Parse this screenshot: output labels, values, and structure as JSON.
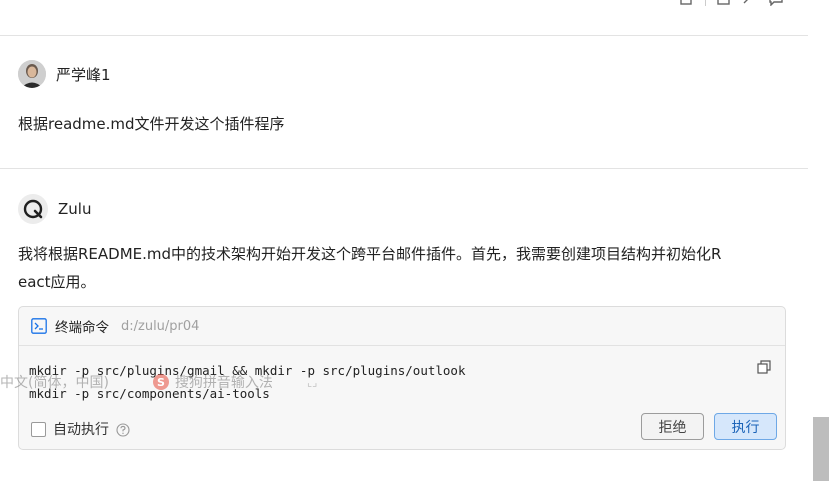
{
  "user_message": {
    "author": "严学峰1",
    "text": "根据readme.md文件开发这个插件程序"
  },
  "ai_message": {
    "author": "Zulu",
    "text_line1": "我将根据README.md中的技术架构开始开发这个跨平台邮件插件。首先，我需要创建项目结构并初始化R",
    "text_line2": "eact应用。"
  },
  "terminal": {
    "title": "终端命令",
    "path": "d:/zulu/pr04",
    "command_line1": "mkdir -p src/plugins/gmail && mkdir -p src/plugins/outlook",
    "command_line2": "mkdir -p src/components/ai-tools",
    "auto_exec_label": "自动执行",
    "reject_label": "拒绝",
    "execute_label": "执行"
  },
  "ime": {
    "lang": "中文(简体，中国)",
    "name": "搜狗拼音输入法",
    "logo": "S"
  },
  "colors": {
    "execute_bg": "#d6e7fb",
    "execute_text": "#1a63b8",
    "terminal_icon": "#1a73e8"
  }
}
